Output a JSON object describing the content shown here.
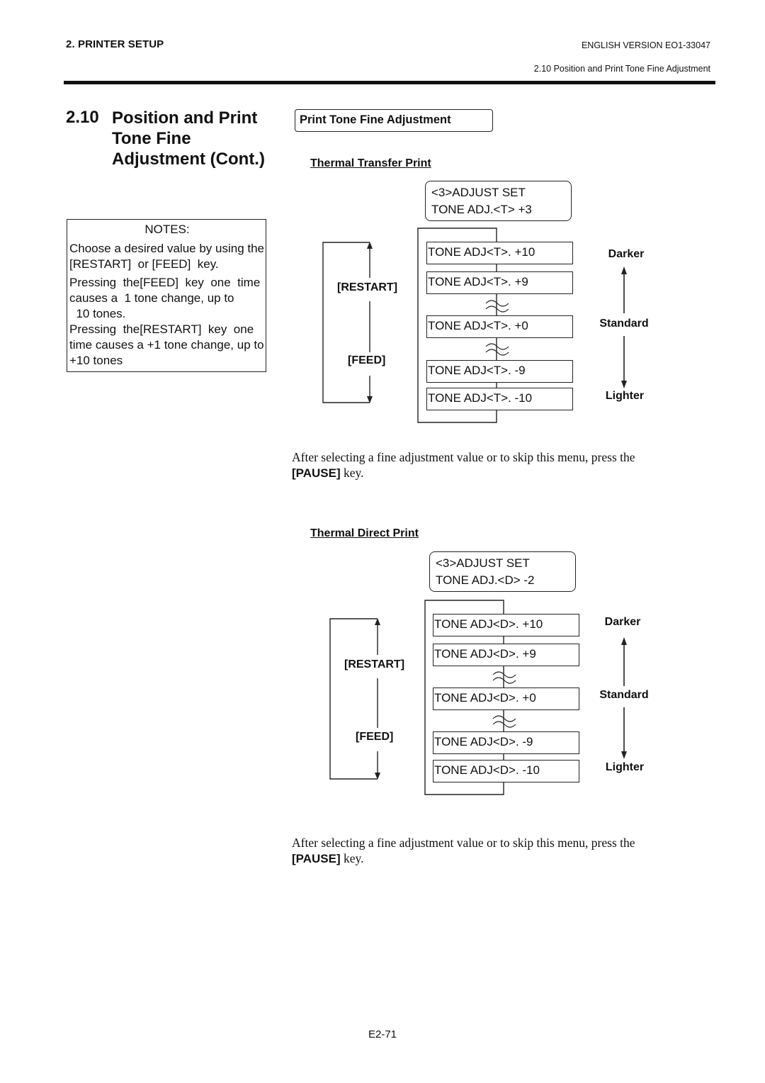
{
  "header": {
    "chapter": "2. PRINTER SETUP",
    "version": "ENGLISH VERSION EO1-33047",
    "section_ref": "2.10 Position and Print Tone Fine Adjustment"
  },
  "section": {
    "number": "2.10",
    "title_lines": [
      "Position and Print",
      "Tone Fine",
      "Adjustment (Cont.)"
    ]
  },
  "notes": {
    "title": "NOTES:",
    "paragraphs": [
      [
        "Choose a desired value by using the",
        "[RESTART]  or [FEED]  key."
      ],
      [
        "Pressing  the[FEED]  key  one  time",
        "causes a  1 tone change, up to",
        "  10 tones."
      ],
      [
        "Pressing  the[RESTART]  key  one",
        "time causes a +1 tone change, up to",
        "+10 tones"
      ]
    ]
  },
  "tag": "Print Tone Fine Adjustment",
  "diagrams": [
    {
      "heading": "Thermal Transfer Print",
      "lcd": [
        "<3>ADJUST SET",
        "TONE ADJ.<T> +3"
      ],
      "values": [
        "TONE ADJ<T>. +10",
        "TONE ADJ<T>. +9",
        "TONE ADJ<T>. +0",
        "TONE ADJ<T>. -9",
        "TONE ADJ<T>. -10"
      ],
      "keys": {
        "up": "[RESTART]",
        "down": "[FEED]"
      },
      "scale": {
        "top": "Darker",
        "middle": "Standard",
        "bottom": "Lighter"
      },
      "after_text": "After selecting a fine adjustment value or to skip this menu, press the",
      "after_key": "[PAUSE]",
      "after_tail": " key."
    },
    {
      "heading": "Thermal Direct Print",
      "lcd": [
        "<3>ADJUST SET",
        "TONE ADJ.<D> -2"
      ],
      "values": [
        "TONE ADJ<D>. +10",
        "TONE ADJ<D>. +9",
        "TONE ADJ<D>. +0",
        "TONE ADJ<D>. -9",
        "TONE ADJ<D>. -10"
      ],
      "keys": {
        "up": "[RESTART]",
        "down": "[FEED]"
      },
      "scale": {
        "top": "Darker",
        "middle": "Standard",
        "bottom": "Lighter"
      },
      "after_text": "After selecting a fine adjustment value or to skip this menu, press the",
      "after_key": "[PAUSE]",
      "after_tail": " key."
    }
  ],
  "footer": {
    "page_number": "E2-71"
  }
}
